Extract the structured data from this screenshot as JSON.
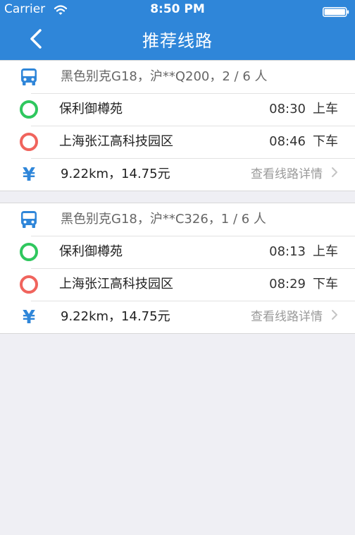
{
  "status_bar": {
    "carrier": "Carrier",
    "time": "8:50 PM"
  },
  "nav": {
    "title": "推荐线路"
  },
  "colors": {
    "header_blue": "#2f86d9",
    "pickup_green": "#2fc75e",
    "dropoff_red": "#f0645d",
    "secondary_gray": "#9a9a9a",
    "background": "#efeff4"
  },
  "icons": {
    "back": "chevron-left-icon",
    "vehicle": "bus-icon",
    "pickup": "green-ring-icon",
    "dropoff": "red-ring-icon",
    "fare": "yen-icon",
    "detail": "chevron-right-icon",
    "wifi": "wifi-icon",
    "battery": "battery-icon"
  },
  "routes": [
    {
      "vehicle": "黑色别克G18，沪**Q200，2 / 6 人",
      "pickup": {
        "place": "保利御樽苑",
        "time": "08:30",
        "action": "上车"
      },
      "dropoff": {
        "place": "上海张江高科技园区",
        "time": "08:46",
        "action": "下车"
      },
      "fare": "9.22km，14.75元",
      "detail_label": "查看线路详情"
    },
    {
      "vehicle": "黑色别克G18，沪**C326，1 / 6 人",
      "pickup": {
        "place": "保利御樽苑",
        "time": "08:13",
        "action": "上车"
      },
      "dropoff": {
        "place": "上海张江高科技园区",
        "time": "08:29",
        "action": "下车"
      },
      "fare": "9.22km，14.75元",
      "detail_label": "查看线路详情"
    }
  ]
}
